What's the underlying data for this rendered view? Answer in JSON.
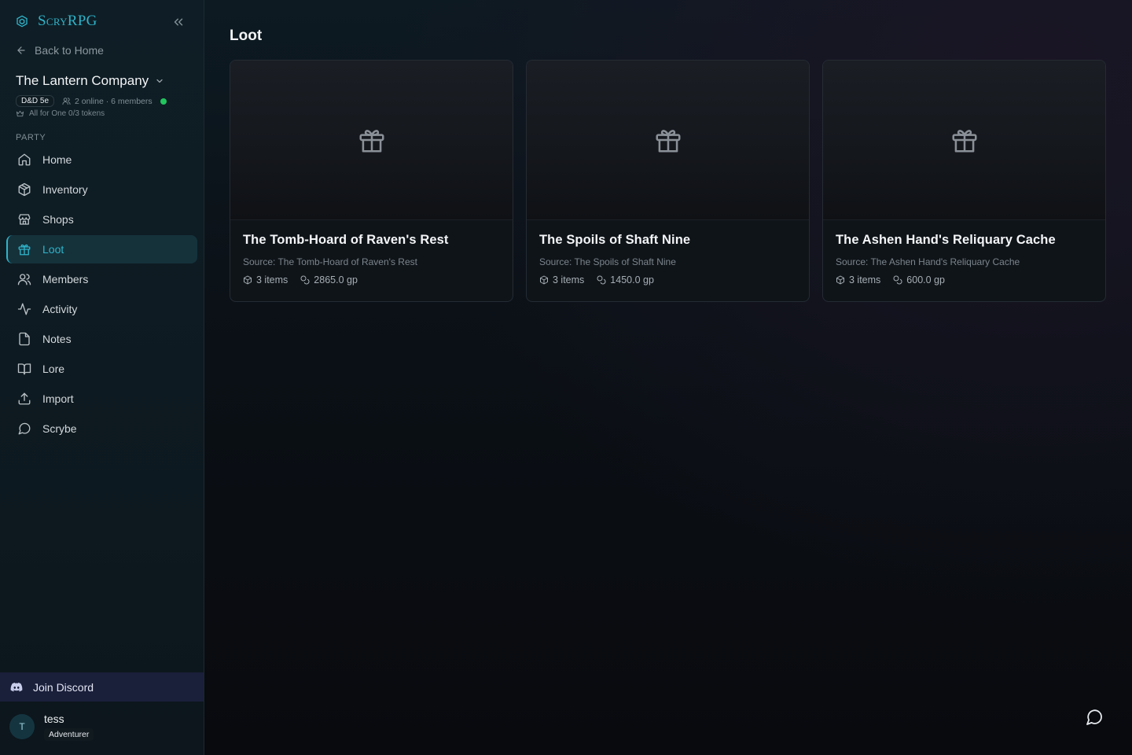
{
  "brand": {
    "name": "ScryRPG",
    "accent": "#2fb3c9"
  },
  "sidebar": {
    "back_label": "Back to Home",
    "campaign": {
      "name": "The Lantern Company",
      "system": "D&D 5e",
      "members_text": "2 online · 6 members",
      "tokens_text": "All for One 0/3 tokens"
    },
    "section_label": "PARTY",
    "items": [
      {
        "label": "Home",
        "icon": "home-icon"
      },
      {
        "label": "Inventory",
        "icon": "package-icon"
      },
      {
        "label": "Shops",
        "icon": "store-icon"
      },
      {
        "label": "Loot",
        "icon": "gift-icon",
        "active": true
      },
      {
        "label": "Members",
        "icon": "users-icon"
      },
      {
        "label": "Activity",
        "icon": "activity-icon"
      },
      {
        "label": "Notes",
        "icon": "file-icon"
      },
      {
        "label": "Lore",
        "icon": "book-icon"
      },
      {
        "label": "Import",
        "icon": "upload-icon"
      },
      {
        "label": "Scrybe",
        "icon": "chat-icon"
      }
    ],
    "discord_label": "Join Discord",
    "user": {
      "initial": "T",
      "name": "tess",
      "role": "Adventurer"
    }
  },
  "main": {
    "title": "Loot",
    "cards": [
      {
        "title": "The Tomb-Hoard of Raven's Rest",
        "source": "Source: The Tomb-Hoard of Raven's Rest",
        "items": "3 items",
        "value": "2865.0 gp"
      },
      {
        "title": "The Spoils of Shaft Nine",
        "source": "Source: The Spoils of Shaft Nine",
        "items": "3 items",
        "value": "1450.0 gp"
      },
      {
        "title": "The Ashen Hand's Reliquary Cache",
        "source": "Source: The Ashen Hand's Reliquary Cache",
        "items": "3 items",
        "value": "600.0 gp"
      }
    ]
  }
}
